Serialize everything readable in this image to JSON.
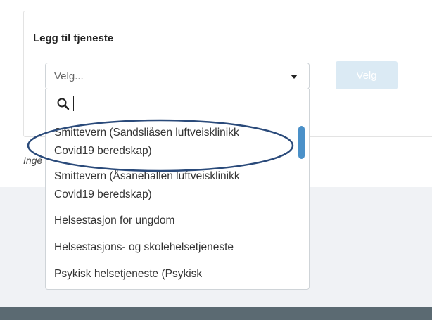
{
  "form": {
    "title": "Legg til tjeneste",
    "select_value": "Velg...",
    "button_label": "Velg",
    "empty_note": "Inge"
  },
  "dropdown": {
    "search_value": "",
    "options": [
      "Smittevern (Sandsliåsen luftveisklinikk Covid19 beredskap)",
      "Smittevern (Åsanehallen luftveisklinikk Covid19 beredskap)",
      "Helsestasjon for ungdom",
      "Helsestasjons- og skolehelsetjeneste",
      "Psykisk helsetjeneste (Psykisk"
    ]
  },
  "colors": {
    "accent": "#4a90c8",
    "disabled_button": "#dbeaf4",
    "annotation": "#2a4a7a",
    "footer": "#5b6a72"
  },
  "icons": [
    "search-icon",
    "chevron-down-icon"
  ]
}
